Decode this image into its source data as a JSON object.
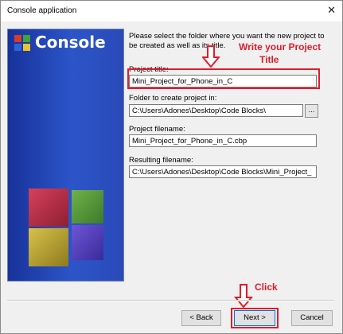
{
  "window": {
    "title": "Console application",
    "close_glyph": "✕"
  },
  "banner": {
    "title": "Console",
    "logo_icon": "codeblocks-logo-icon"
  },
  "form": {
    "intro": "Please select the folder where you want the new project to be created as well as its title.",
    "project_title_label": "Project title:",
    "project_title_value": "Mini_Project_for_Phone_in_C",
    "folder_label": "Folder to create project in:",
    "folder_value": "C:\\Users\\Adones\\Desktop\\Code Blocks\\",
    "browse_label": "...",
    "filename_label": "Project filename:",
    "filename_value": "Mini_Project_for_Phone_in_C.cbp",
    "resulting_label": "Resulting filename:",
    "resulting_value": "C:\\Users\\Adones\\Desktop\\Code Blocks\\Mini_Project_"
  },
  "annotations": {
    "write_title": "Write your Project",
    "write_title_2": "Title",
    "click": "Click",
    "color": "#e01d2b"
  },
  "buttons": {
    "back": "< Back",
    "next": "Next >",
    "cancel": "Cancel"
  }
}
